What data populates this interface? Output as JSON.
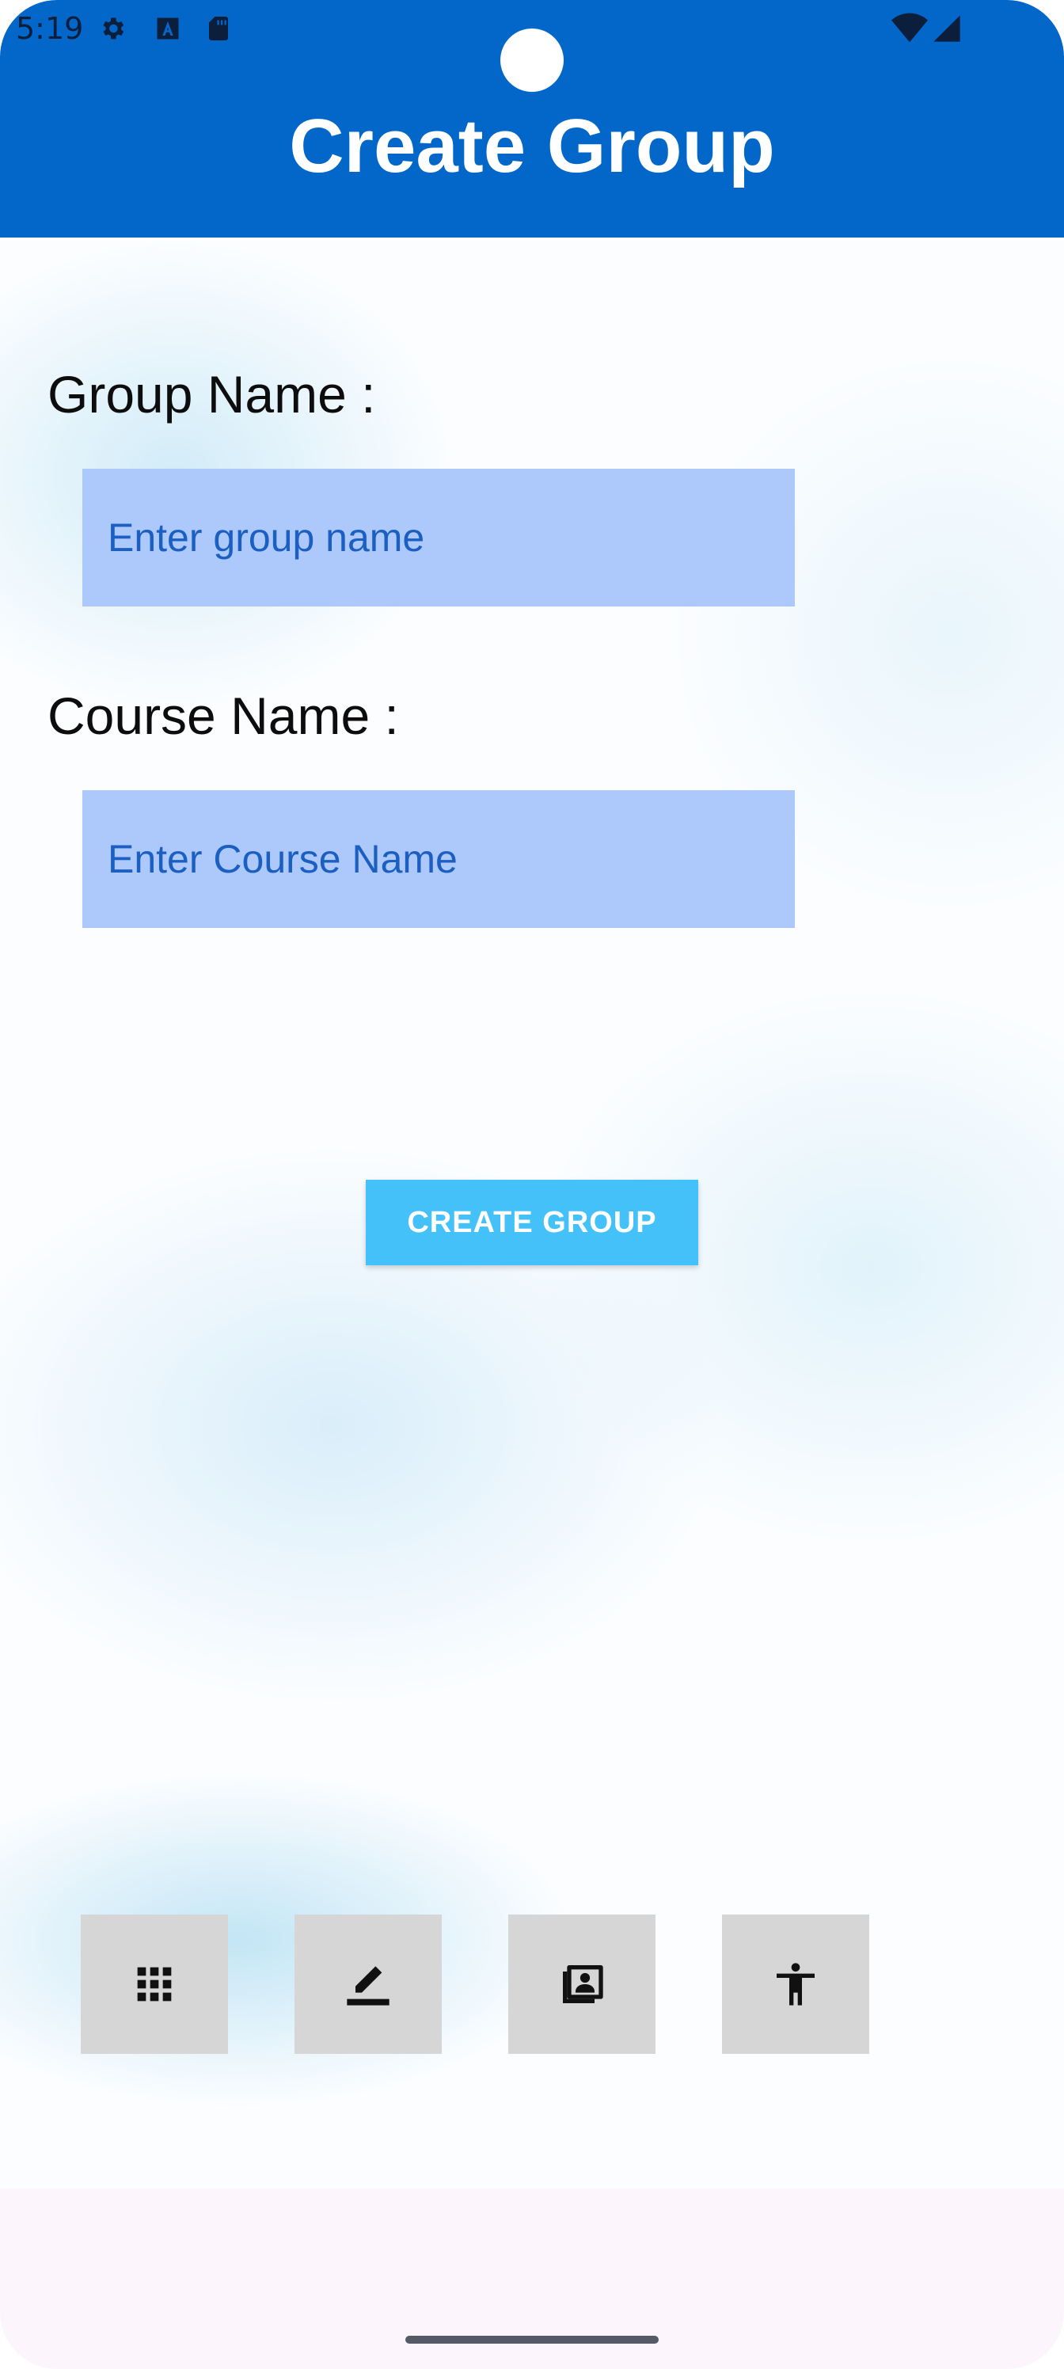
{
  "status_bar": {
    "time": "5:19",
    "icons": [
      "gear-icon",
      "font-a-icon",
      "sd-card-icon",
      "wifi-icon",
      "signal-icon"
    ]
  },
  "app_bar": {
    "title": "Create Group",
    "background_color": "#0366c9"
  },
  "form": {
    "group_name_label": "Group Name :",
    "group_name_placeholder": "Enter group name",
    "group_name_value": "",
    "course_name_label": "Course Name :",
    "course_name_placeholder": "Enter Course Name",
    "course_name_value": "",
    "field_color": "#adc8fa",
    "create_button_label": "CREATE GROUP",
    "create_button_color": "#44c1f9"
  },
  "toolbar": {
    "buttons": [
      {
        "icon": "grid-icon"
      },
      {
        "icon": "edit-icon"
      },
      {
        "icon": "contact-card-icon"
      },
      {
        "icon": "accessibility-icon"
      }
    ]
  }
}
